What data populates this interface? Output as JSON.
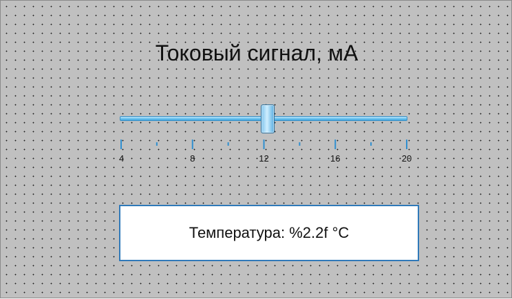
{
  "title": "Токовый сигнал, мА",
  "slider": {
    "min": 4,
    "max": 20,
    "value": 12.2,
    "tick_labels": [
      "4",
      "8",
      "12",
      "16",
      "20"
    ],
    "minor_ticks": [
      6,
      10,
      14,
      18
    ],
    "track_color": "#5bb8ea",
    "thumb_color": "#9dd6f5"
  },
  "readout": {
    "text": "Температура: %2.2f °C",
    "border_color": "#2f79b9"
  }
}
